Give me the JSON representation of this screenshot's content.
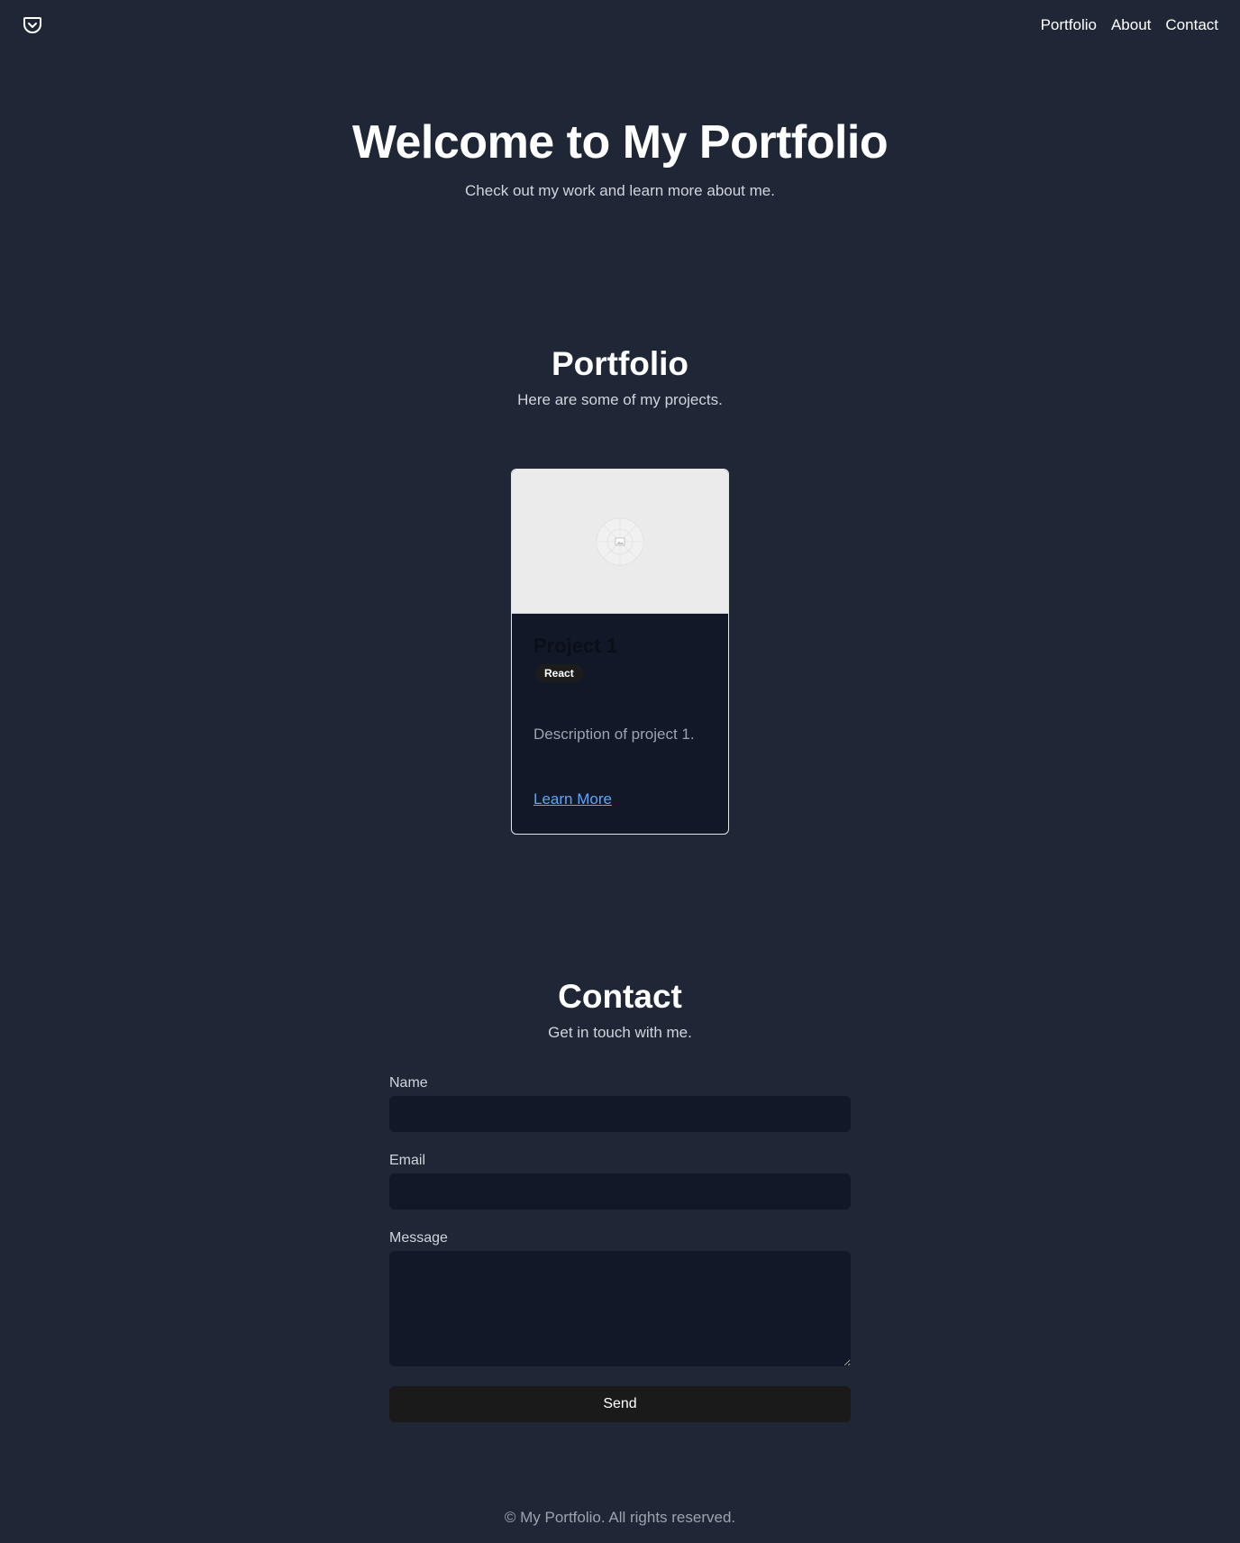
{
  "header": {
    "logo_icon": "pocket-icon",
    "nav": [
      {
        "label": "Portfolio"
      },
      {
        "label": "About"
      },
      {
        "label": "Contact"
      }
    ]
  },
  "hero": {
    "title": "Welcome to My Portfolio",
    "subtitle": "Check out my work and learn more about me."
  },
  "portfolio": {
    "title": "Portfolio",
    "subtitle": "Here are some of my projects.",
    "projects": [
      {
        "title": "Project 1",
        "badge": "React",
        "description": "Description of project 1.",
        "link_label": "Learn More",
        "image_icon": "image-placeholder-icon"
      }
    ]
  },
  "contact": {
    "title": "Contact",
    "subtitle": "Get in touch with me.",
    "fields": {
      "name_label": "Name",
      "name_value": "",
      "email_label": "Email",
      "email_value": "",
      "message_label": "Message",
      "message_value": ""
    },
    "submit_label": "Send"
  },
  "footer": {
    "text": "© My Portfolio. All rights reserved."
  },
  "colors": {
    "background": "#1f2736",
    "surface": "#111827",
    "link": "#60a5fa",
    "button": "#1a1a1a"
  }
}
